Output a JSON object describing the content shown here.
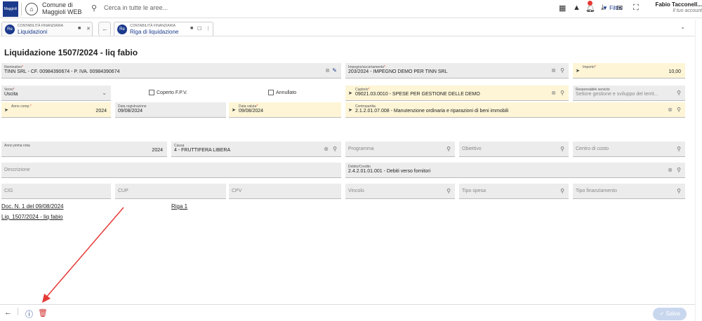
{
  "topbar": {
    "logo_text": "Maggioli",
    "app_name_1": "Comune di",
    "app_name_2": "Maggioli WEB",
    "search_placeholder": "Cerca in tutte le aree...",
    "filter_label": "Filtra",
    "user_name": "Fabio Tacconell...",
    "user_sub": "Il tuo account"
  },
  "tabs": [
    {
      "badge": "Re",
      "small": "CONTABILITÀ FINANZIARIA",
      "big": "Liquidazioni"
    },
    {
      "badge": "Re",
      "small": "CONTABILITÀ FINANZIARIA",
      "big": "Riga di liquidazione"
    }
  ],
  "title": "Liquidazione 1507/2024 - liq fabio",
  "fields": {
    "nominativo": {
      "label": "Nominativo",
      "value": "TINN SRL - CF. 00984390674 - P. IVA. 00984390674"
    },
    "impegno": {
      "label": "Impegno/accertamento",
      "value": "203/2024 - IMPEGNO DEMO PER TINN SRL"
    },
    "importo": {
      "label": "Importo",
      "value": "10,00"
    },
    "verso": {
      "label": "Verso",
      "value": "Uscita"
    },
    "coperto": {
      "label": "Coperto F.P.V."
    },
    "annullato": {
      "label": "Annullato"
    },
    "capitolo": {
      "label": "Capitolo",
      "value": "09021.03.0010 - SPESE PER GESTIONE DELLE DEMO"
    },
    "responsabile": {
      "label": "Responsabile servizio",
      "value": "Settore gestione e sviluppo del territ..."
    },
    "anno_comp": {
      "label": "Anno comp.",
      "value": "2024"
    },
    "data_reg": {
      "label": "Data registrazione",
      "value": "09/08/2024"
    },
    "data_valuta": {
      "label": "Data valuta",
      "value": "09/08/2024"
    },
    "contropartita": {
      "label": "Contropartita",
      "value": "2.1.2.01.07.008 - Manutenzione ordinaria e riparazioni di beni immobili"
    },
    "anno_prima_nota": {
      "label": "Anno prima nota",
      "value": "2024"
    },
    "causa": {
      "label": "Causa",
      "value": "4 - FRUTTIFERA LIBERA"
    },
    "programma": {
      "label": "Programma"
    },
    "obiettivo": {
      "label": "Obiettivo"
    },
    "centro_costo": {
      "label": "Centro di costo"
    },
    "descrizione": {
      "label": "Descrizione"
    },
    "debito": {
      "label": "Debito/Credito",
      "value": "2.4.2.01.01.001 - Debiti verso fornitori"
    },
    "cig": {
      "label": "CIG"
    },
    "cup": {
      "label": "CUP"
    },
    "cpv": {
      "label": "CPV"
    },
    "vincolo": {
      "label": "Vincolo"
    },
    "tipo_spesa": {
      "label": "Tipo spesa"
    },
    "tipo_fin": {
      "label": "Tipo finanziamento"
    }
  },
  "links": {
    "doc": "Doc. N. 1 del 09/08/2024",
    "riga": "Riga 1",
    "liq": "Liq. 1507/2024 - liq fabio"
  },
  "bottom": {
    "save_label": "Salva"
  },
  "colors": {
    "brand": "#1b3a8c",
    "required": "#e53935",
    "delete": "#d32f2f",
    "annotation_arrow": "#e53935"
  }
}
